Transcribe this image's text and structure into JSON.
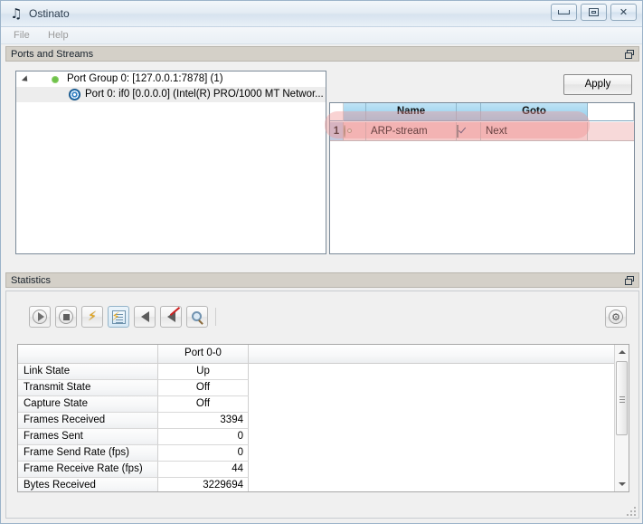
{
  "window": {
    "title": "Ostinato",
    "app_icon": "ostinato-logo-icon",
    "buttons": {
      "minimize": "minimize-icon",
      "maximize": "maximize-icon",
      "close": "✕"
    }
  },
  "menubar": {
    "items": [
      {
        "label": "File"
      },
      {
        "label": "Help"
      }
    ]
  },
  "ports_panel": {
    "title": "Ports and Streams",
    "float_icon": "undock-icon",
    "tree": {
      "nodes": [
        {
          "label": "Port Group 0:  [127.0.0.1:7878] (1)",
          "expander": "expanded-triangle-icon",
          "status_icon": "green-status-dot-icon"
        },
        {
          "label": "Port 0: if0  [0.0.0.0] (Intel(R) PRO/1000 MT Networ...",
          "status_icon": "port-target-icon",
          "selected": true
        }
      ]
    },
    "apply_button": "Apply",
    "streams_table": {
      "headers": [
        "",
        "",
        "Name",
        "",
        "Goto",
        ""
      ],
      "rows": [
        {
          "num": "1",
          "icon": "stream-gear-icon",
          "name": "ARP-stream",
          "enabled": true,
          "goto": "Next"
        }
      ]
    }
  },
  "statistics_panel": {
    "title": "Statistics",
    "float_icon": "undock-icon",
    "toolbar": [
      {
        "name": "start-transmit-button",
        "icon": "play-icon"
      },
      {
        "name": "stop-transmit-button",
        "icon": "stop-icon"
      },
      {
        "name": "start-capture-button",
        "icon": "bolt-icon"
      },
      {
        "name": "view-capture-button",
        "icon": "bolt-document-icon"
      },
      {
        "name": "resolve-neighbors-button",
        "icon": "speaker-icon"
      },
      {
        "name": "clear-neighbors-button",
        "icon": "speaker-muted-icon"
      },
      {
        "name": "find-button",
        "icon": "magnifier-icon"
      }
    ],
    "toolbar_right": {
      "name": "preferences-button",
      "icon": "settings-icon",
      "glyph": "⚙"
    },
    "table": {
      "corner_header": "",
      "column_headers": [
        "Port 0-0"
      ],
      "rows": [
        {
          "label": "Link State",
          "value": "Up",
          "align": "center"
        },
        {
          "label": "Transmit State",
          "value": "Off",
          "align": "center"
        },
        {
          "label": "Capture State",
          "value": "Off",
          "align": "center"
        },
        {
          "label": "Frames Received",
          "value": "3394",
          "align": "right"
        },
        {
          "label": "Frames Sent",
          "value": "0",
          "align": "right"
        },
        {
          "label": "Frame Send Rate (fps)",
          "value": "0",
          "align": "right"
        },
        {
          "label": "Frame Receive Rate (fps)",
          "value": "44",
          "align": "right"
        },
        {
          "label": "Bytes Received",
          "value": "3229694",
          "align": "right"
        }
      ]
    },
    "scrollbar": {
      "up": "scroll-up-arrow-icon",
      "down": "scroll-down-arrow-icon"
    }
  },
  "colors": {
    "titlebar": "#e4ecf4",
    "dock_title": "#d4d0c8",
    "header_blue": "#a8d8f0",
    "highlight_pink": "#f0a0a0",
    "row_num_blue": "#c3c9de",
    "status_green": "#6fc24a"
  }
}
